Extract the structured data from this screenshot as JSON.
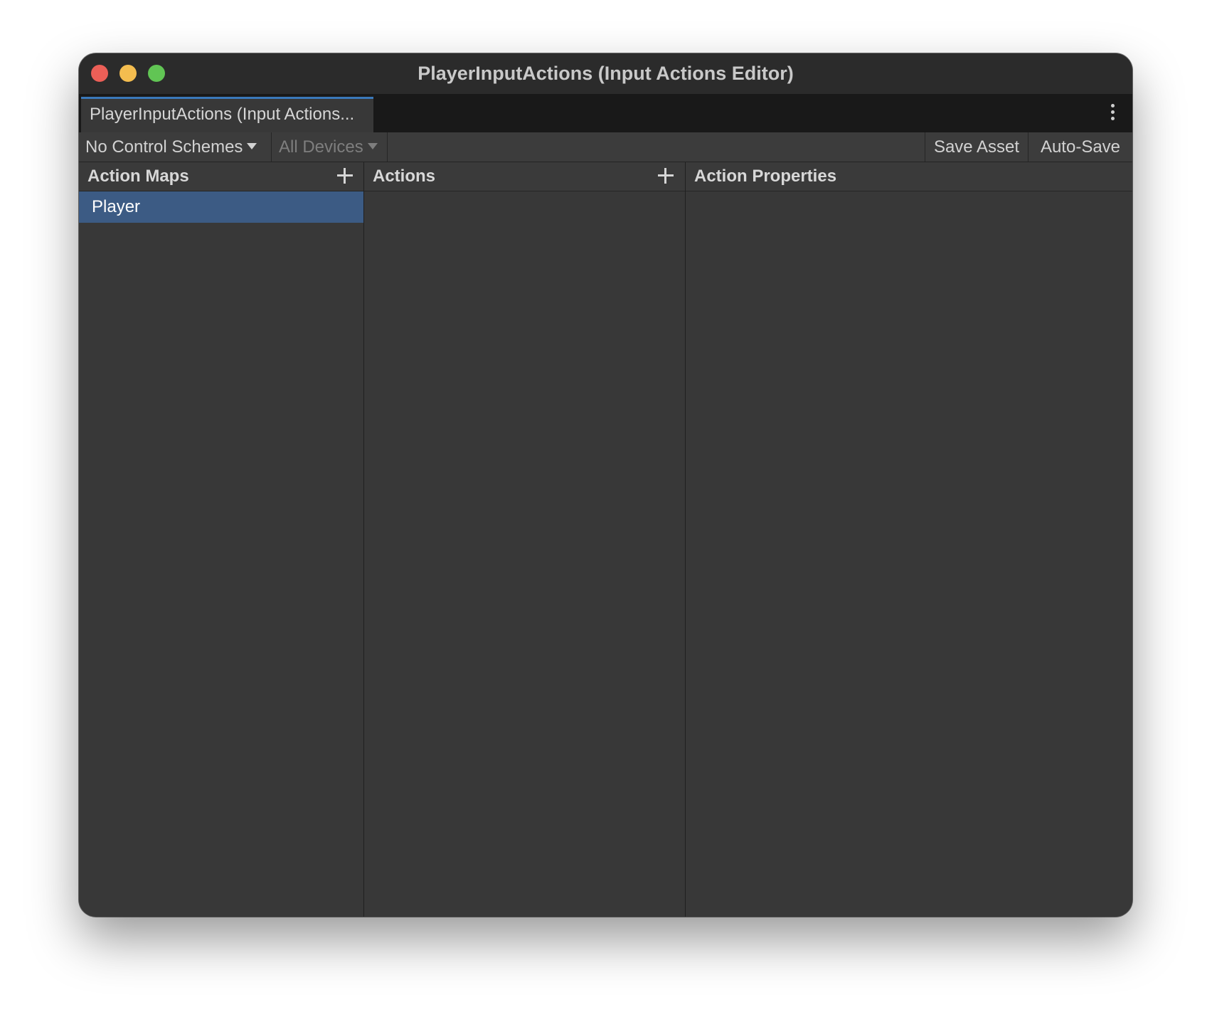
{
  "window": {
    "title": "PlayerInputActions (Input Actions Editor)",
    "traffic_lights": {
      "close_color": "#ec5f57",
      "minimize_color": "#f4bd4f",
      "maximize_color": "#61c554"
    }
  },
  "tab": {
    "label": "PlayerInputActions (Input Actions...",
    "accent_color": "#3a79bb"
  },
  "menu_icon": "kebab-menu-icon",
  "toolbar": {
    "control_schemes": "No Control Schemes",
    "devices": "All Devices",
    "save_asset": "Save Asset",
    "auto_save": "Auto-Save"
  },
  "panels": {
    "action_maps": {
      "title": "Action Maps",
      "add_icon": "plus-icon",
      "items": [
        {
          "label": "Player",
          "selected": true
        }
      ]
    },
    "actions": {
      "title": "Actions",
      "add_icon": "plus-icon"
    },
    "properties": {
      "title": "Action Properties"
    }
  },
  "colors": {
    "selection": "#3c5b84",
    "panel_background": "#383838"
  }
}
